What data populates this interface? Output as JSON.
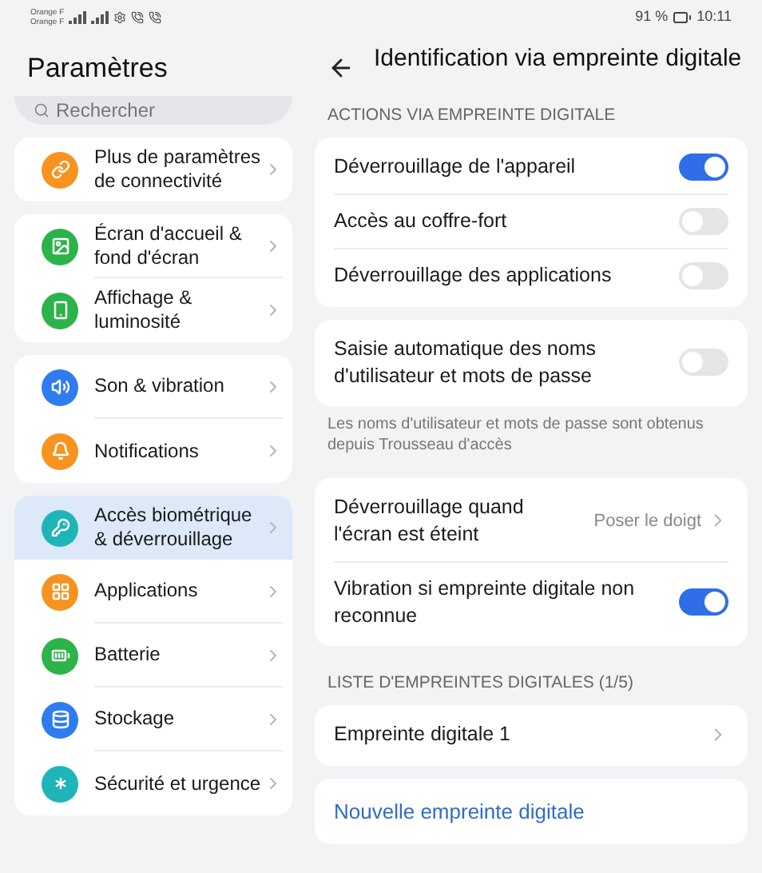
{
  "status_bar": {
    "carriers": [
      "Orange F",
      "Orange F"
    ],
    "battery": "91 %",
    "time": "10:11"
  },
  "sidebar": {
    "title": "Paramètres",
    "search": {
      "placeholder": "Rechercher"
    },
    "groups": [
      {
        "items": [
          {
            "label": "Plus de paramètres de connectivité",
            "kind": "link",
            "color": "#f7931e",
            "selected": false
          }
        ]
      },
      {
        "items": [
          {
            "label": "Écran d'accueil & fond d'écran",
            "kind": "image",
            "color": "#2cb34a",
            "selected": false
          },
          {
            "label": "Affichage & luminosité",
            "kind": "phone",
            "color": "#2cb34a",
            "selected": false
          }
        ]
      },
      {
        "items": [
          {
            "label": "Son & vibration",
            "kind": "sound",
            "color": "#2f7cf0",
            "selected": false
          },
          {
            "label": "Notifications",
            "kind": "bell",
            "color": "#f7931e",
            "selected": false
          }
        ]
      },
      {
        "items": [
          {
            "label": "Accès biométrique & déverrouillage",
            "kind": "key",
            "color": "#1fb5b8",
            "selected": true
          },
          {
            "label": "Applications",
            "kind": "grid",
            "color": "#f7931e",
            "selected": false
          },
          {
            "label": "Batterie",
            "kind": "battery",
            "color": "#2cb34a",
            "selected": false
          },
          {
            "label": "Stockage",
            "kind": "storage",
            "color": "#2f7cf0",
            "selected": false
          },
          {
            "label": "Sécurité et urgence",
            "kind": "asterisk",
            "color": "#1fb5b8",
            "selected": false
          }
        ]
      }
    ]
  },
  "page": {
    "title": "Identification via empreinte digitale",
    "sections": [
      {
        "header": "ACTIONS VIA EMPREINTE DIGITALE",
        "cards": [
          {
            "rows": [
              {
                "kind": "toggle",
                "label": "Déverrouillage de l'appareil",
                "on": true
              },
              {
                "kind": "toggle",
                "label": "Accès au coffre-fort",
                "on": false
              },
              {
                "kind": "toggle",
                "label": "Déverrouillage des applications",
                "on": false
              }
            ]
          },
          {
            "rows": [
              {
                "kind": "toggle",
                "label": "Saisie automatique des noms d'utilisateur et mots de passe",
                "on": false
              }
            ],
            "note": "Les noms d'utilisateur et mots de passe sont obtenus depuis Trousseau d'accès"
          },
          {
            "rows": [
              {
                "kind": "nav",
                "label": "Déverrouillage quand l'écran est éteint",
                "value": "Poser le doigt"
              },
              {
                "kind": "toggle",
                "label": "Vibration si empreinte digitale non reconnue",
                "on": true
              }
            ]
          }
        ]
      },
      {
        "header": "LISTE D'EMPREINTES DIGITALES (1/5)",
        "cards": [
          {
            "rows": [
              {
                "kind": "nav",
                "label": "Empreinte digitale 1"
              }
            ]
          },
          {
            "rows": [
              {
                "kind": "action",
                "label": "Nouvelle empreinte digitale"
              }
            ]
          }
        ]
      }
    ]
  }
}
